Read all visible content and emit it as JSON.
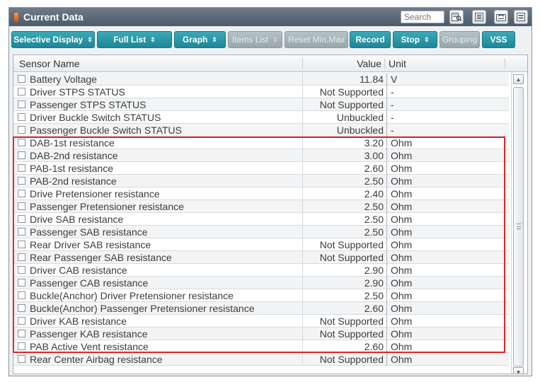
{
  "window": {
    "title": "Current Data",
    "search_placeholder": "Search"
  },
  "toolbar_icons": [
    "find-icon",
    "list-icon",
    "retry-icon",
    "menu-icon"
  ],
  "toolbar": {
    "selective_display": "Selective Display",
    "full_list": "Full List",
    "graph": "Graph",
    "items_list": "Items List",
    "reset_min_max": "Reset Min.Max",
    "record": "Record",
    "stop": "Stop",
    "grouping": "Grouping",
    "vss": "VSS"
  },
  "grid": {
    "columns": [
      "Sensor Name",
      "Value",
      "Unit"
    ],
    "rows": [
      {
        "name": "Battery Voltage",
        "value": "11.84",
        "unit": "V"
      },
      {
        "name": "Driver STPS STATUS",
        "value": "Not Supported",
        "unit": "-"
      },
      {
        "name": "Passenger STPS STATUS",
        "value": "Not Supported",
        "unit": "-"
      },
      {
        "name": "Driver Buckle Switch STATUS",
        "value": "Unbuckled",
        "unit": "-"
      },
      {
        "name": "Passenger Buckle Switch STATUS",
        "value": "Unbuckled",
        "unit": "-"
      },
      {
        "name": "DAB-1st resistance",
        "value": "3.20",
        "unit": "Ohm"
      },
      {
        "name": "DAB-2nd resistance",
        "value": "3.00",
        "unit": "Ohm"
      },
      {
        "name": "PAB-1st resistance",
        "value": "2.60",
        "unit": "Ohm"
      },
      {
        "name": "PAB-2nd resistance",
        "value": "2.50",
        "unit": "Ohm"
      },
      {
        "name": "Drive Pretensioner resistance",
        "value": "2.40",
        "unit": "Ohm"
      },
      {
        "name": "Passenger Pretensioner resistance",
        "value": "2.50",
        "unit": "Ohm"
      },
      {
        "name": "Drive SAB resistance",
        "value": "2.50",
        "unit": "Ohm"
      },
      {
        "name": "Passenger SAB resistance",
        "value": "2.50",
        "unit": "Ohm"
      },
      {
        "name": "Rear Driver SAB resistance",
        "value": "Not Supported",
        "unit": "Ohm"
      },
      {
        "name": "Rear Passenger SAB resistance",
        "value": "Not Supported",
        "unit": "Ohm"
      },
      {
        "name": "Driver CAB resistance",
        "value": "2.90",
        "unit": "Ohm"
      },
      {
        "name": "Passenger CAB resistance",
        "value": "2.90",
        "unit": "Ohm"
      },
      {
        "name": "Buckle(Anchor) Driver Pretensioner resistance",
        "value": "2.50",
        "unit": "Ohm"
      },
      {
        "name": "Buckle(Anchor) Passenger Pretensioner resistance",
        "value": "2.60",
        "unit": "Ohm"
      },
      {
        "name": "Driver KAB resistance",
        "value": "Not Supported",
        "unit": "Ohm"
      },
      {
        "name": "Passenger KAB resistance",
        "value": "Not Supported",
        "unit": "Ohm"
      },
      {
        "name": "PAB Active Vent resistance",
        "value": "2.60",
        "unit": "Ohm"
      },
      {
        "name": "Rear Center Airbag resistance",
        "value": "Not Supported",
        "unit": "Ohm"
      }
    ]
  },
  "colors": {
    "button": "#1d8797",
    "highlight": "#e0262b",
    "titlebar": "#4d5a68"
  }
}
